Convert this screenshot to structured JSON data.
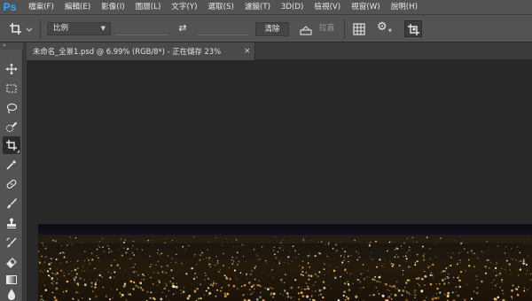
{
  "app": {
    "logo": "Ps"
  },
  "menu": {
    "items": [
      "檔案(F)",
      "編輯(E)",
      "影像(I)",
      "圖層(L)",
      "文字(Y)",
      "選取(S)",
      "濾鏡(T)",
      "3D(D)",
      "檢視(V)",
      "視窗(W)",
      "說明(H)"
    ]
  },
  "options": {
    "ratio_value": "比例",
    "clear_label": "清除",
    "straighten_label": "拉直"
  },
  "document": {
    "tab_title": "未命名_全景1.psd @ 6.99% (RGB/8*) - 正在儲存 23%",
    "close_glyph": "×"
  },
  "toolbox": {
    "grip_glyph": "»",
    "tools": [
      "move-tool",
      "marquee-tool",
      "lasso-tool",
      "quick-select-tool",
      "crop-tool",
      "eyedropper-tool",
      "healing-brush-tool",
      "brush-tool",
      "clone-stamp-tool",
      "history-brush-tool",
      "eraser-tool",
      "gradient-tool",
      "blur-tool"
    ],
    "active_tool": "crop-tool"
  },
  "colors": {
    "ui_panel": "#535353",
    "workspace": "#282828",
    "ps_logo": "#31a8ff"
  }
}
